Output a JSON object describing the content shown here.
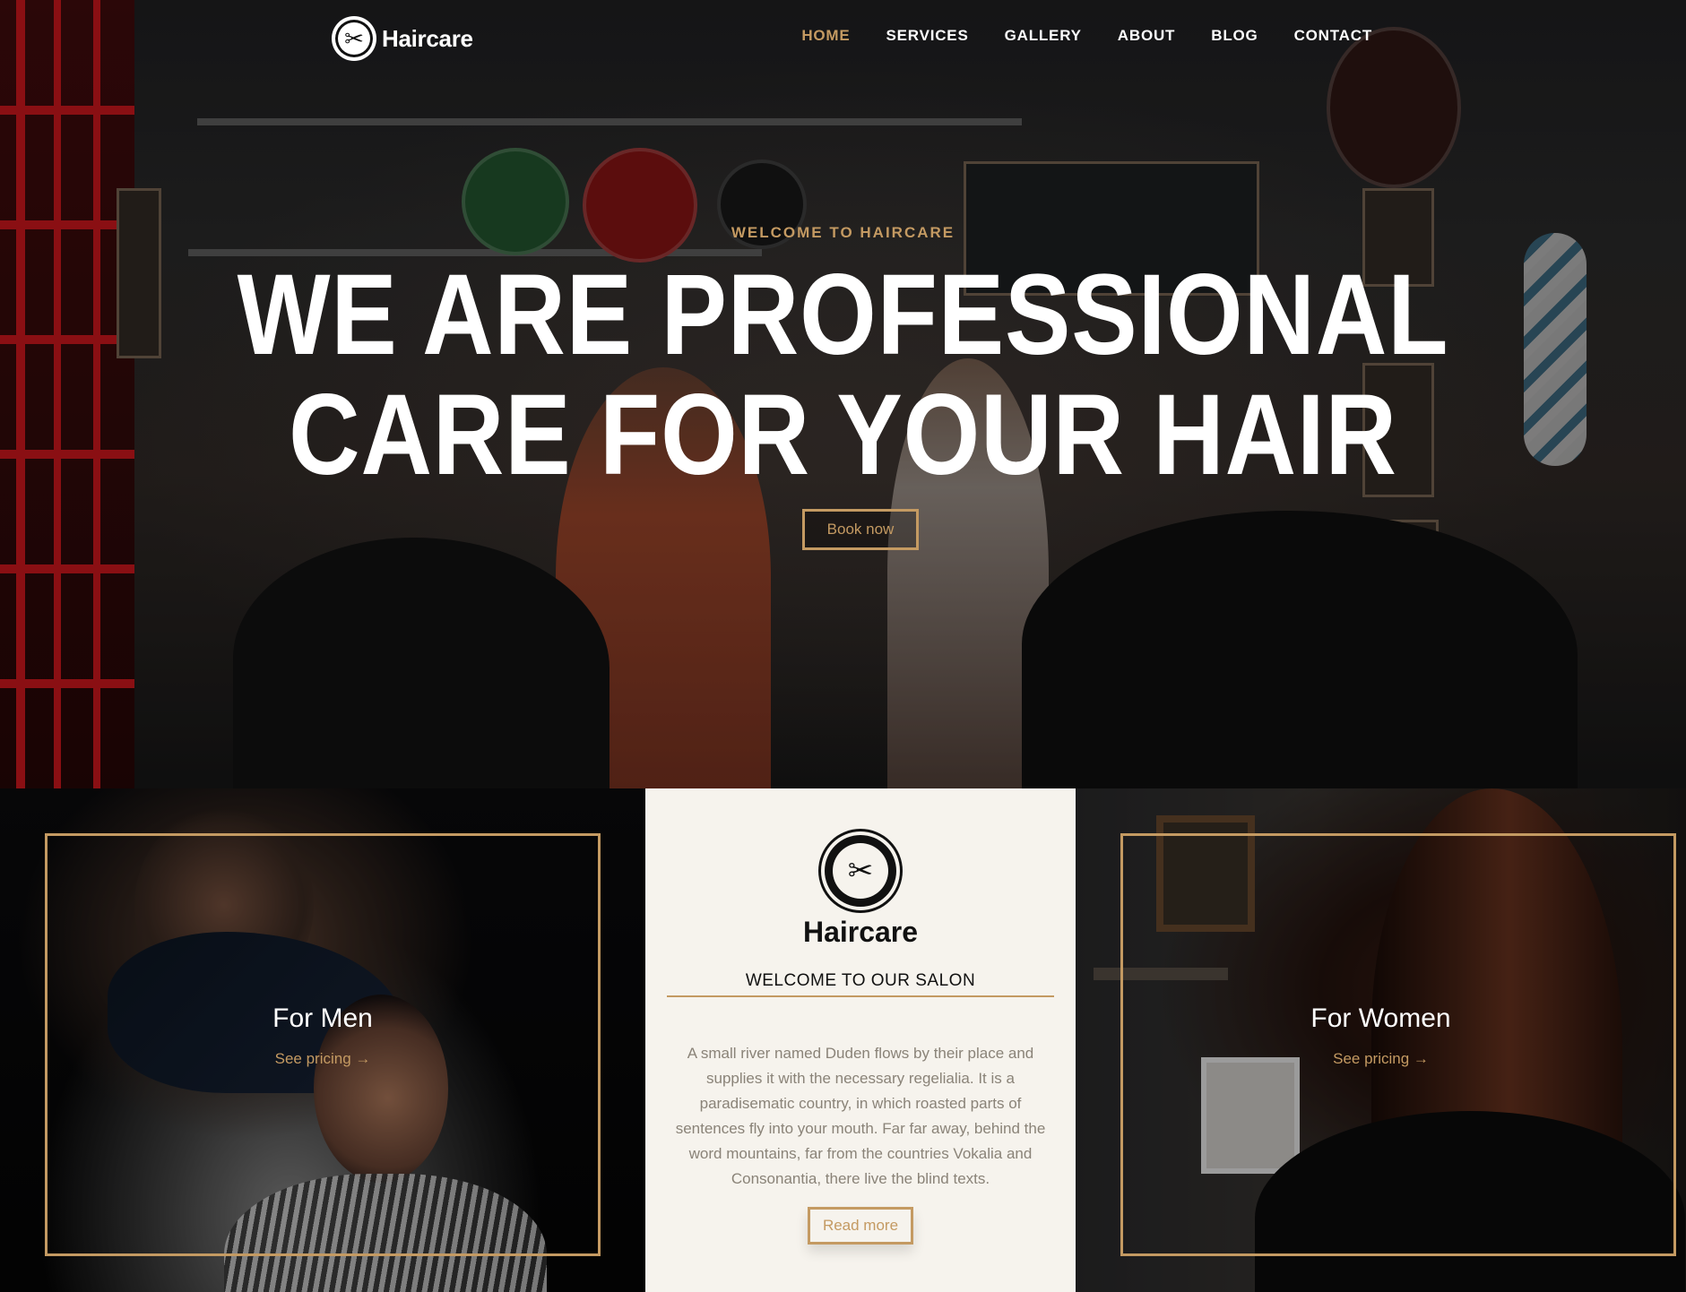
{
  "brand": {
    "name": "Haircare"
  },
  "nav": {
    "items": [
      {
        "label": "HOME",
        "active": true
      },
      {
        "label": "SERVICES",
        "active": false
      },
      {
        "label": "GALLERY",
        "active": false
      },
      {
        "label": "ABOUT",
        "active": false
      },
      {
        "label": "BLOG",
        "active": false
      },
      {
        "label": "CONTACT",
        "active": false
      }
    ]
  },
  "hero": {
    "eyebrow": "WELCOME TO HAIRCARE",
    "headline_line1": "WE ARE PROFESSIONAL",
    "headline_line2": "CARE FOR YOUR HAIR",
    "cta": "Book now"
  },
  "panels": {
    "men": {
      "title": "For Men",
      "link": "See pricing →"
    },
    "women": {
      "title": "For Women",
      "link": "See pricing →"
    },
    "center": {
      "brand": "Haircare",
      "subtitle": "WELCOME TO OUR SALON",
      "body": "A small river named Duden flows by their place and supplies it with the necessary regelialia. It is a paradisematic country, in which roasted parts of sentences fly into your mouth. Far far away, behind the word mountains, far from the countries Vokalia and Consonantia, there live the blind texts.",
      "button": "Read more"
    }
  },
  "colors": {
    "accent": "#c49a62",
    "light_panel": "#f6f3ed",
    "text_muted": "#8a8378"
  },
  "icons": {
    "logo": "scissors-icon"
  }
}
